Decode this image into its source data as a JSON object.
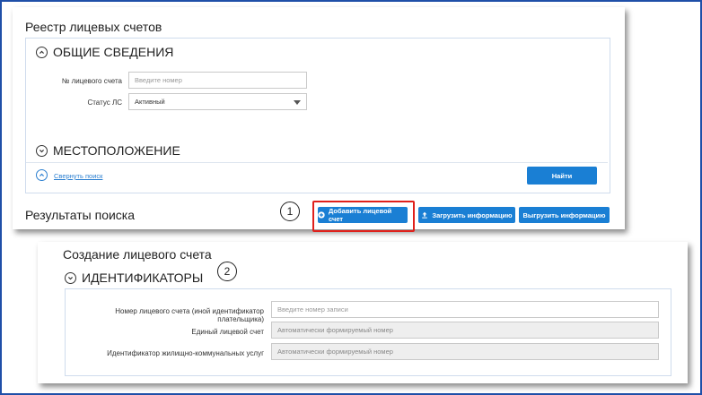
{
  "registry": {
    "title": "Реестр лицевых счетов",
    "section_general": "ОБЩИЕ СВЕДЕНИЯ",
    "account_label": "№ лицевого счета",
    "account_placeholder": "Введите номер",
    "status_label": "Статус ЛС",
    "status_value": "Активный",
    "section_location": "МЕСТОПОЛОЖЕНИЕ",
    "collapse_link": "Свернуть поиск",
    "find_button": "Найти",
    "results_title": "Результаты поиска",
    "add_button": "Добавить лицевой счет",
    "upload_button": "Загрузить информацию",
    "download_button": "Выгрузить информацию"
  },
  "create": {
    "title": "Создание лицевого счета",
    "section_ids": "ИДЕНТИФИКАТОРЫ",
    "account_number_label": "Номер лицевого счета (иной идентификатор плательщика)",
    "account_number_placeholder": "Введите номер записи",
    "unified_label": "Единый лицевой счет",
    "unified_value": "Автоматически формируемый номер",
    "housing_label": "Идентификатор жилищно-коммунальных услуг",
    "housing_value": "Автоматически формируемый номер"
  },
  "callouts": {
    "one": "1",
    "two": "2"
  },
  "colors": {
    "primary": "#1a7fd4",
    "highlight": "#e0201b",
    "frame": "#1f4fa8"
  },
  "icons": {
    "expand": "chevron-up-circle-icon",
    "collapse": "chevron-down-circle-icon",
    "add": "plus-circle-icon",
    "upload": "upload-icon"
  }
}
